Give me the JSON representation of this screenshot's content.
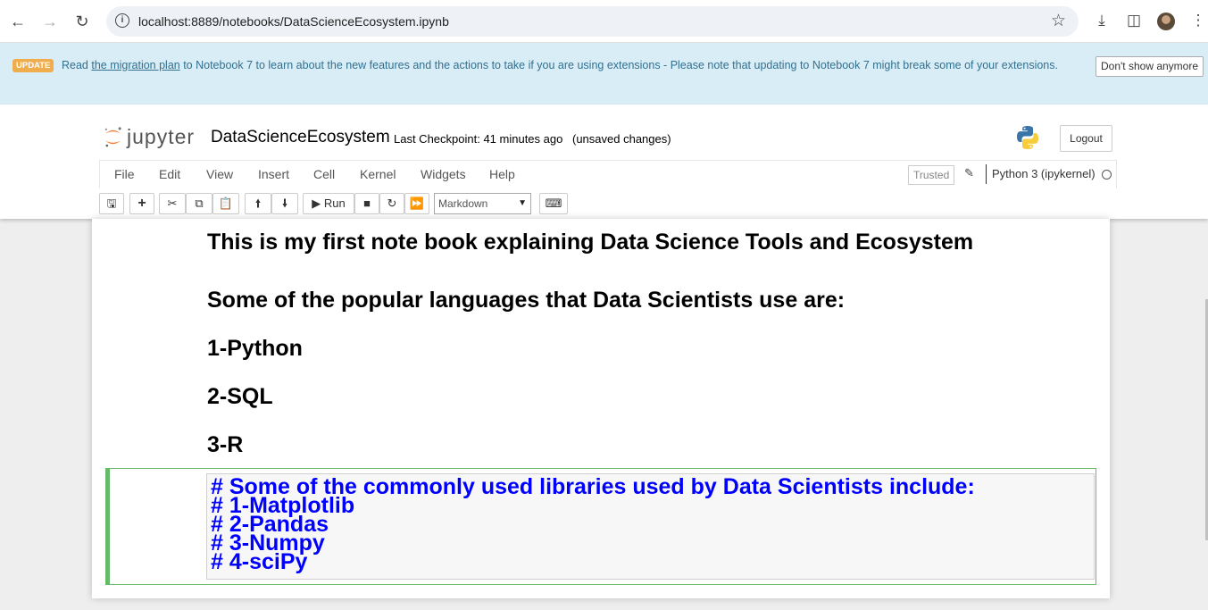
{
  "browser": {
    "url": "localhost:8889/notebooks/DataScienceEcosystem.ipynb",
    "icons": [
      "back-icon",
      "forward-icon",
      "reload-icon",
      "site-info-icon",
      "bookmark-star-icon",
      "download-icon",
      "side-panel-icon",
      "profile-avatar",
      "more-menu-icon"
    ]
  },
  "banner": {
    "badge": "UPDATE",
    "text_before": "Read ",
    "link": "the migration plan",
    "text_after": " to Notebook 7 to learn about the new features and the actions to take if you are using extensions - Please note that updating to Notebook 7 might break some of your extensions.",
    "dismiss": "Don't show anymore"
  },
  "header": {
    "logo_text": "jupyter",
    "notebook_name": "DataScienceEcosystem",
    "checkpoint": "Last Checkpoint: 41 minutes ago",
    "unsaved": "(unsaved changes)",
    "logout": "Logout"
  },
  "menubar": {
    "items": [
      "File",
      "Edit",
      "View",
      "Insert",
      "Cell",
      "Kernel",
      "Widgets",
      "Help"
    ],
    "trusted": "Trusted",
    "kernel": "Python 3 (ipykernel)"
  },
  "toolbar": {
    "run_label": "Run",
    "cell_type": "Markdown",
    "icons": [
      "save-icon",
      "add-cell-icon",
      "cut-icon",
      "copy-icon",
      "paste-icon",
      "move-up-icon",
      "move-down-icon",
      "run-icon",
      "stop-icon",
      "restart-icon",
      "fast-forward-icon",
      "keyboard-icon"
    ]
  },
  "cells": {
    "rendered": [
      "This is my first note book explaining Data Science Tools and Ecosystem",
      "Some of the popular languages that Data Scientists use are:",
      "1-Python",
      "2-SQL",
      "3-R"
    ],
    "editing": [
      "# Some of the commonly used libraries used by Data Scientists include:",
      "# 1-Matplotlib",
      "# 2-Pandas",
      "# 3-Numpy",
      "# 4-sciPy"
    ]
  },
  "colors": {
    "banner_bg": "#d9edf7",
    "banner_text": "#31708f",
    "badge": "#f0ad4e",
    "edit_border": "#66bb6a",
    "markdown_heading_edit": "#0000ff"
  }
}
